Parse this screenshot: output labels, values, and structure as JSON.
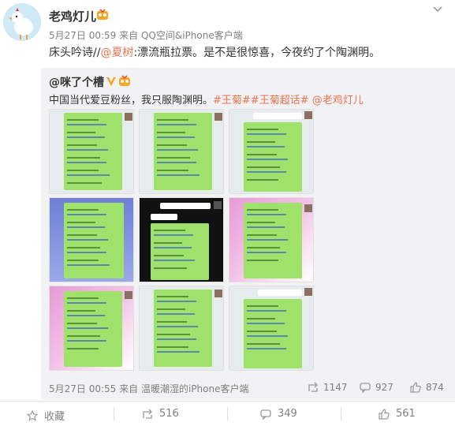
{
  "post": {
    "author": "老鸡灯儿",
    "meta_time": "5月27日 00:59",
    "meta_from": "来自",
    "meta_source": "QQ空间&iPhone客户端",
    "text_prefix": "床头吟诗//",
    "mention": "@夏树",
    "text_suffix": ":漂流瓶拉票。是不是很惊喜，今夜约了个陶渊明。"
  },
  "repost": {
    "author": "@咪了个槽",
    "text_prefix": "中国当代爱豆粉丝，我只服陶渊明。",
    "tags": "#王菊##王菊超话# @老鸡灯儿",
    "footer_time": "5月27日 00:55",
    "footer_from": "来自",
    "footer_source": "温暖潮湿的iPhone客户端",
    "reposts": "1147",
    "comments": "927",
    "likes": "874"
  },
  "actions": {
    "favorite": "收藏",
    "repost": "516",
    "comment": "349",
    "like": "561"
  },
  "images": [
    {
      "theme": "green"
    },
    {
      "theme": "green"
    },
    {
      "theme": "green"
    },
    {
      "theme": "blue"
    },
    {
      "theme": "black"
    },
    {
      "theme": "pink"
    },
    {
      "theme": "pink"
    },
    {
      "theme": "green"
    },
    {
      "theme": "green"
    }
  ],
  "colors": {
    "accent": "#eb7350",
    "muted": "#808080",
    "repost_bg": "#f2f2f5",
    "chat_bubble": "#9ee26b"
  }
}
